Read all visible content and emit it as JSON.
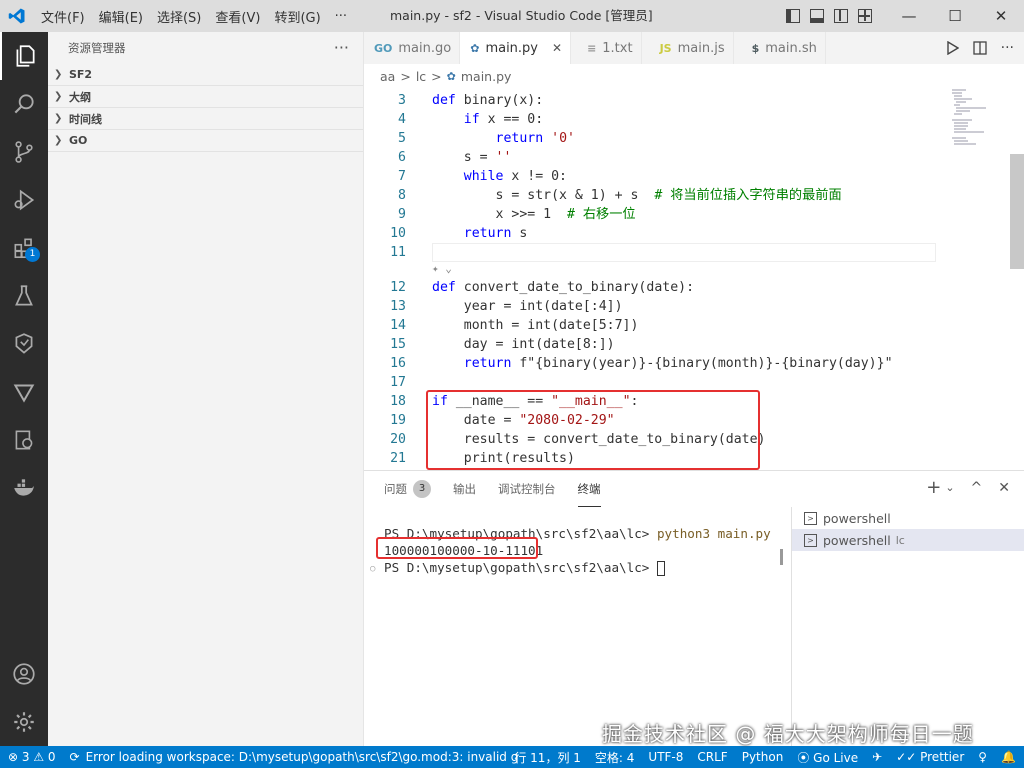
{
  "window": {
    "title": "main.py - sf2 - Visual Studio Code [管理员]",
    "menu": [
      "文件(F)",
      "编辑(E)",
      "选择(S)",
      "查看(V)",
      "转到(G)",
      "···"
    ],
    "controls": {
      "minimize": "—",
      "maximize": "☐",
      "close": "✕"
    }
  },
  "activity": {
    "extensions_badge": "1"
  },
  "sidebar": {
    "title": "资源管理器",
    "more": "···",
    "sections": [
      "SF2",
      "大纲",
      "时间线",
      "GO"
    ]
  },
  "tabs": [
    {
      "label": "main.go",
      "icon": "GO",
      "color": "#519aba"
    },
    {
      "label": "main.py",
      "icon": "✿",
      "color": "#3c78aa",
      "close": "✕"
    },
    {
      "label": "1.txt",
      "icon": "≡",
      "color": "#999999"
    },
    {
      "label": "main.js",
      "icon": "JS",
      "color": "#cbcb41"
    },
    {
      "label": "main.sh",
      "icon": "$",
      "color": "#4d5a5e"
    }
  ],
  "breadcrumb": [
    "aa",
    ">",
    "lc",
    ">",
    "main.py"
  ],
  "editor": {
    "codelens": "✦ ⌄",
    "lines": [
      {
        "n": "3",
        "tokens": [
          {
            "t": "def ",
            "c": "kw"
          },
          {
            "t": "binary(x):",
            "c": "fn"
          }
        ]
      },
      {
        "n": "4",
        "tokens": [
          {
            "t": "    ",
            "c": "fn"
          },
          {
            "t": "if",
            "c": "kw"
          },
          {
            "t": " x == 0:",
            "c": "fn"
          }
        ]
      },
      {
        "n": "5",
        "tokens": [
          {
            "t": "        ",
            "c": "fn"
          },
          {
            "t": "return",
            "c": "kw"
          },
          {
            "t": " ",
            "c": "fn"
          },
          {
            "t": "'0'",
            "c": "str"
          }
        ]
      },
      {
        "n": "6",
        "tokens": [
          {
            "t": "    s = ",
            "c": "fn"
          },
          {
            "t": "''",
            "c": "str"
          }
        ]
      },
      {
        "n": "7",
        "tokens": [
          {
            "t": "    ",
            "c": "fn"
          },
          {
            "t": "while",
            "c": "kw"
          },
          {
            "t": " x != 0:",
            "c": "fn"
          }
        ]
      },
      {
        "n": "8",
        "tokens": [
          {
            "t": "        s = str(x & 1) + s  ",
            "c": "fn"
          },
          {
            "t": "# 将当前位插入字符串的最前面",
            "c": "cm"
          }
        ]
      },
      {
        "n": "9",
        "tokens": [
          {
            "t": "        x >>= 1  ",
            "c": "fn"
          },
          {
            "t": "# 右移一位",
            "c": "cm"
          }
        ]
      },
      {
        "n": "10",
        "tokens": [
          {
            "t": "    ",
            "c": "fn"
          },
          {
            "t": "return",
            "c": "kw"
          },
          {
            "t": " s",
            "c": "fn"
          }
        ]
      },
      {
        "n": "11",
        "tokens": []
      },
      {
        "n": "12",
        "tokens": [
          {
            "t": "def ",
            "c": "kw"
          },
          {
            "t": "convert_date_to_binary(date):",
            "c": "fn"
          }
        ]
      },
      {
        "n": "13",
        "tokens": [
          {
            "t": "    year = int(date[:4])",
            "c": "fn"
          }
        ]
      },
      {
        "n": "14",
        "tokens": [
          {
            "t": "    month = int(date[5:7])",
            "c": "fn"
          }
        ]
      },
      {
        "n": "15",
        "tokens": [
          {
            "t": "    day = int(date[8:])",
            "c": "fn"
          }
        ]
      },
      {
        "n": "16",
        "tokens": [
          {
            "t": "    ",
            "c": "fn"
          },
          {
            "t": "return",
            "c": "kw"
          },
          {
            "t": " f\"{binary(year)}-{binary(month)}-{binary(day)}\"",
            "c": "fn"
          }
        ]
      },
      {
        "n": "17",
        "tokens": []
      },
      {
        "n": "18",
        "tokens": [
          {
            "t": "if",
            "c": "kw"
          },
          {
            "t": " __name__ == ",
            "c": "fn"
          },
          {
            "t": "\"__main__\"",
            "c": "str"
          },
          {
            "t": ":",
            "c": "fn"
          }
        ]
      },
      {
        "n": "19",
        "tokens": [
          {
            "t": "    date = ",
            "c": "fn"
          },
          {
            "t": "\"2080-02-29\"",
            "c": "str"
          }
        ]
      },
      {
        "n": "20",
        "tokens": [
          {
            "t": "    results = convert_date_to_binary(date)",
            "c": "fn"
          }
        ]
      },
      {
        "n": "21",
        "tokens": [
          {
            "t": "    print(results)",
            "c": "fn"
          }
        ]
      }
    ]
  },
  "panel": {
    "tabs": [
      "问题",
      "输出",
      "调试控制台",
      "终端"
    ],
    "problems_count": "3",
    "actions": [
      "+",
      "⌄",
      "^",
      "✕"
    ],
    "terminal": {
      "prompt1": "PS D:\\mysetup\\gopath\\src\\sf2\\aa\\lc> ",
      "command": "python3 main.py",
      "output": "100000100000-10-11101",
      "prompt2": "PS D:\\mysetup\\gopath\\src\\sf2\\aa\\lc> "
    },
    "terminals": [
      {
        "name": "powershell",
        "extra": ""
      },
      {
        "name": "powershell",
        "extra": "lc"
      }
    ]
  },
  "status": {
    "problems": "⊗ 3 ⚠ 0",
    "loading": "Error loading workspace: D:\\mysetup\\gopath\\src\\sf2\\go.mod:3: invalid g",
    "cursor": "行 11，列 1",
    "spaces": "空格: 4",
    "encoding": "UTF-8",
    "eol": "CRLF",
    "language": "Python",
    "golive": "Go Live",
    "prettier": "Prettier"
  },
  "watermark": "掘金技术社区 @ 福大大架构师每日一题"
}
